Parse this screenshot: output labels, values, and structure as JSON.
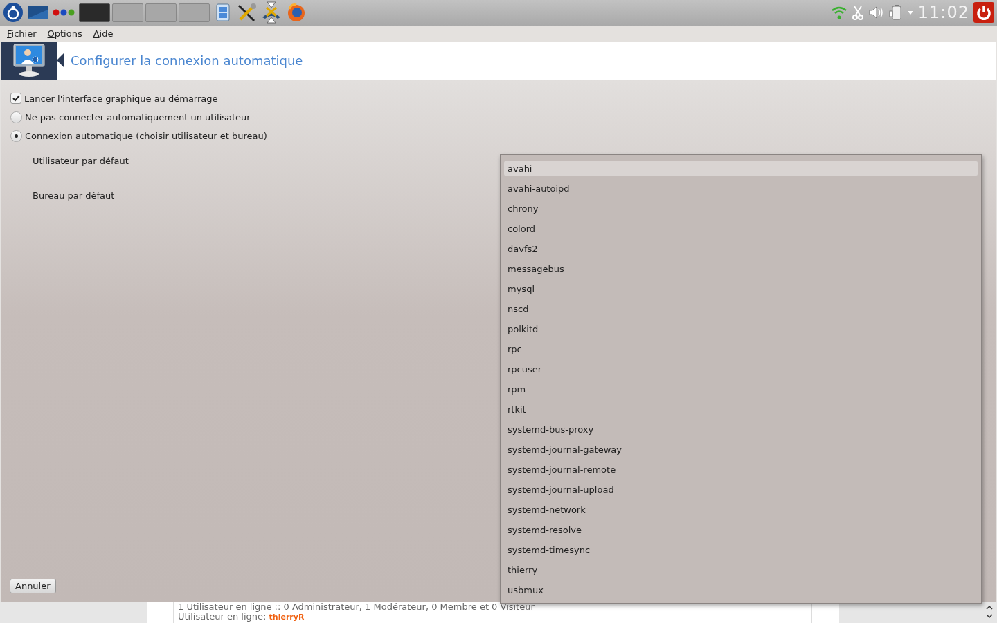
{
  "panel": {
    "workspaces": [
      {
        "selected": true
      },
      {
        "selected": false
      },
      {
        "selected": false
      },
      {
        "selected": false
      }
    ],
    "clock": "11:02"
  },
  "menu": [
    "Fichier",
    "Options",
    "Aide"
  ],
  "header": {
    "title": "Configurer la connexion automatique"
  },
  "options": [
    {
      "kind": "checkbox",
      "label": "Lancer l'interface graphique au démarrage",
      "checked": true
    },
    {
      "kind": "radio",
      "label": "Ne pas connecter automatiquement un utilisateur",
      "selected": false
    },
    {
      "kind": "radio",
      "label": "Connexion automatique (choisir utilisateur et bureau)",
      "selected": true
    }
  ],
  "fields": [
    {
      "label": "Utilisateur par défaut"
    },
    {
      "label": "Bureau par défaut"
    }
  ],
  "buttons": [
    "Annuler"
  ],
  "dropdown": {
    "items": [
      {
        "label": "avahi",
        "selected": true
      },
      {
        "label": "avahi-autoipd",
        "selected": false
      },
      {
        "label": "chrony",
        "selected": false
      },
      {
        "label": "colord",
        "selected": false
      },
      {
        "label": "davfs2",
        "selected": false
      },
      {
        "label": "messagebus",
        "selected": false
      },
      {
        "label": "mysql",
        "selected": false
      },
      {
        "label": "nscd",
        "selected": false
      },
      {
        "label": "polkitd",
        "selected": false
      },
      {
        "label": "rpc",
        "selected": false
      },
      {
        "label": "rpcuser",
        "selected": false
      },
      {
        "label": "rpm",
        "selected": false
      },
      {
        "label": "rtkit",
        "selected": false
      },
      {
        "label": "systemd-bus-proxy",
        "selected": false
      },
      {
        "label": "systemd-journal-gateway",
        "selected": false
      },
      {
        "label": "systemd-journal-remote",
        "selected": false
      },
      {
        "label": "systemd-journal-upload",
        "selected": false
      },
      {
        "label": "systemd-network",
        "selected": false
      },
      {
        "label": "systemd-resolve",
        "selected": false
      },
      {
        "label": "systemd-timesync",
        "selected": false
      },
      {
        "label": "thierry",
        "selected": false
      },
      {
        "label": "usbmux",
        "selected": false
      }
    ]
  },
  "background_page": {
    "lines": [
      "1 Utilisateur en ligne :: 0 Administrateur, 1 Modérateur, 0 Membre et 0 Visiteur"
    ],
    "online_label": "Utilisateur en ligne:",
    "online_user": "thierryR"
  }
}
